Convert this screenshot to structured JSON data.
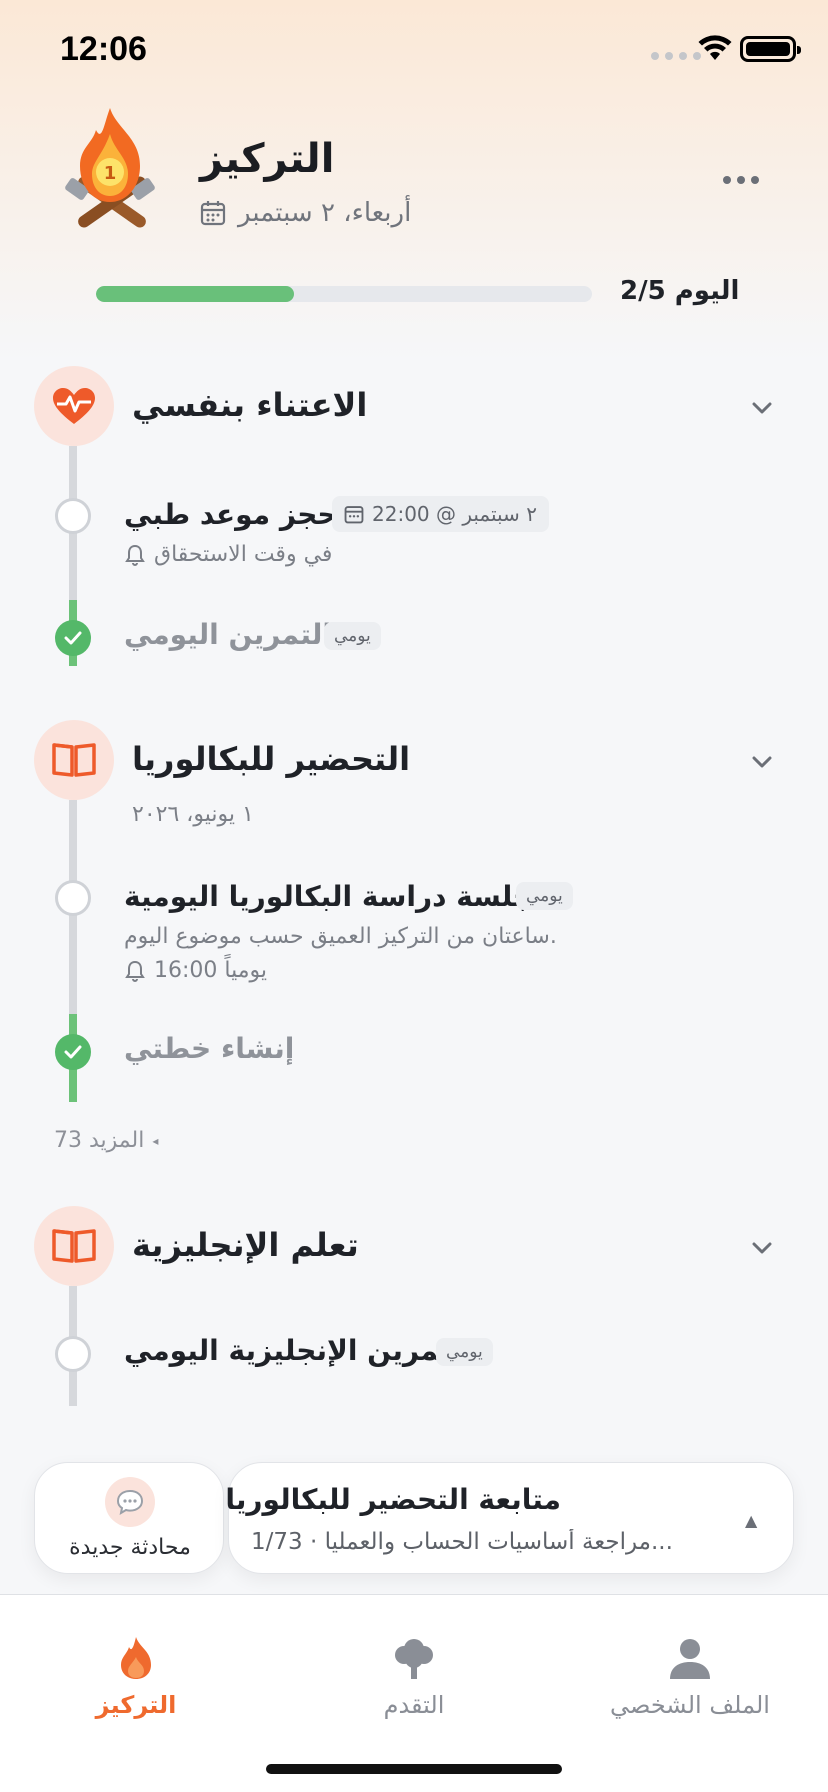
{
  "status_bar": {
    "time": "12:06"
  },
  "header": {
    "title": "التركيز",
    "date": "أربعاء، ٢ سبتمبر",
    "progress_label": "2/5 اليوم",
    "progress_fraction": 0.4
  },
  "sections": [
    {
      "title": "الاعتناء بنفسي",
      "icon": "heart-pulse-icon",
      "tasks": [
        {
          "title": "حجز موعد طبي",
          "due_chip": "٢ سبتمبر @ 22:00",
          "reminder": "في وقت الاستحقاق",
          "done": false
        },
        {
          "title": "التمرين اليومي",
          "badge": "يومي",
          "done": true
        }
      ]
    },
    {
      "title": "التحضير للبكالوريا",
      "icon": "book-icon",
      "deadline": "١ يونيو، ٢٠٢٦",
      "tasks": [
        {
          "title": "جلسة دراسة البكالوريا اليومية",
          "badge": "يومي",
          "description": "ساعتان من التركيز العميق حسب موضوع اليوم.",
          "reminder": "يومياً 16:00",
          "done": false
        },
        {
          "title": "إنشاء خطتي",
          "done": true
        }
      ],
      "more_label": "73 المزيد"
    },
    {
      "title": "تعلم الإنجليزية",
      "icon": "book-icon",
      "tasks": [
        {
          "title": "تمرين الإنجليزية اليومي",
          "badge": "يومي",
          "done": false
        }
      ]
    }
  ],
  "bottom_actions": {
    "new_chat_label": "محادثة جديدة",
    "followup_title": "متابعة التحضير للبكالوريا",
    "followup_subtitle": "1/73 · مراجعة أساسيات الحساب والعمليا..."
  },
  "tabs": [
    {
      "label": "التركيز",
      "icon": "flame-icon",
      "active": true
    },
    {
      "label": "التقدم",
      "icon": "tree-icon",
      "active": false
    },
    {
      "label": "الملف الشخصي",
      "icon": "person-icon",
      "active": false
    }
  ],
  "colors": {
    "accent": "#EF6A2E",
    "success": "#54B869",
    "rail": "#D6D8DC"
  }
}
